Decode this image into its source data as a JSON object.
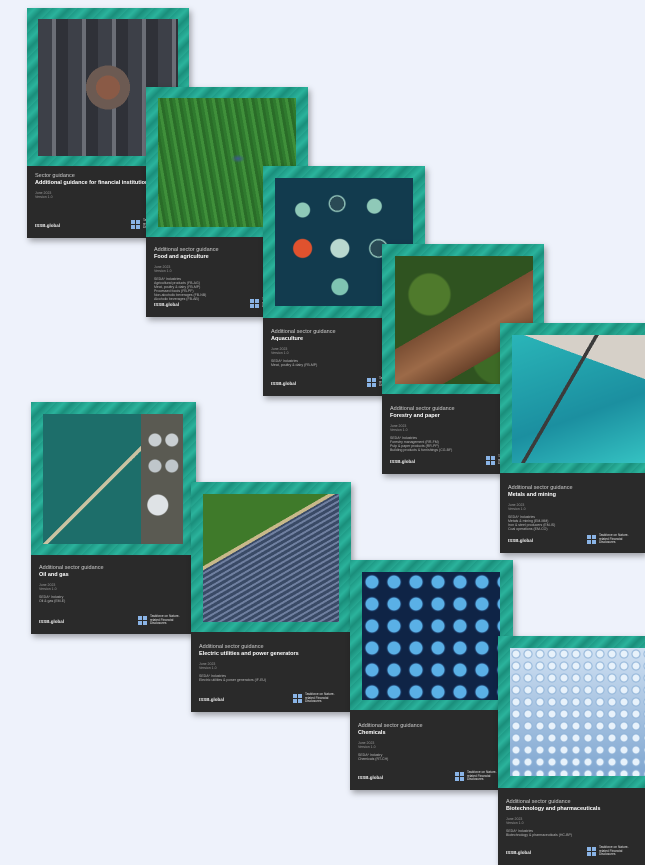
{
  "cards": [
    {
      "kicker": "Sector guidance",
      "title": "Additional guidance for financial institutions",
      "date": "June 2023\nVersion 1.0",
      "industries": "",
      "brand": "ISSB.global",
      "tcfd": "Taskforce on Nature-related Financial Disclosures"
    },
    {
      "kicker": "Additional sector guidance",
      "title": "Food and agriculture",
      "date": "June 2023\nVersion 1.0",
      "industries": "SEDA* Industries\nAgricultural products (FB-AG)\nMeat, poultry & dairy (FB-MP)\nProcessed foods (FB-PF)\nNon-alcoholic beverages (FB-NB)\nAlcoholic beverages (FB-AB)",
      "brand": "ISSB.global",
      "tcfd": "Taskforce on Nature-related Financial Disclosures"
    },
    {
      "kicker": "Additional sector guidance",
      "title": "Aquaculture",
      "date": "June 2023\nVersion 1.0",
      "industries": "SEDA* Industries\nMeat, poultry & dairy (FB-MP)",
      "brand": "ISSB.global",
      "tcfd": "Taskforce on Nature-related Financial Disclosures"
    },
    {
      "kicker": "Additional sector guidance",
      "title": "Forestry and paper",
      "date": "June 2023\nVersion 1.0",
      "industries": "SEDA* Industries\nForestry management (RR-FM)\nPulp & paper products (RR-PP)\nBuilding products & furnishings (CG-BF)",
      "brand": "ISSB.global",
      "tcfd": "Taskforce on Nature-related Financial Disclosures"
    },
    {
      "kicker": "Additional sector guidance",
      "title": "Metals and mining",
      "date": "June 2023\nVersion 1.0",
      "industries": "SEDA* Industries\nMetals & mining (EM-MM)\nIron & steel producers (EM-IS)\nCoal operations (EM-CO)",
      "brand": "ISSB.global",
      "tcfd": "Taskforce on Nature-related Financial Disclosures"
    },
    {
      "kicker": "Additional sector guidance",
      "title": "Oil and gas",
      "date": "June 2023\nVersion 1.0",
      "industries": "SEDA* Industry\nOil & gas (EM-E)",
      "brand": "ISSB.global",
      "tcfd": "Taskforce on Nature-related Financial Disclosures"
    },
    {
      "kicker": "Additional sector guidance",
      "title": "Electric utilities and power generators",
      "date": "June 2023\nVersion 1.0",
      "industries": "SEDA* Industries\nElectric utilities & power generators (IF-EU)",
      "brand": "ISSB.global",
      "tcfd": "Taskforce on Nature-related Financial Disclosures"
    },
    {
      "kicker": "Additional sector guidance",
      "title": "Chemicals",
      "date": "June 2023\nVersion 1.0",
      "industries": "SEDA* Industry\nChemicals (RT-CH)",
      "brand": "ISSB.global",
      "tcfd": "Taskforce on Nature-related Financial Disclosures"
    },
    {
      "kicker": "Additional sector guidance",
      "title": "Biotechnology and pharmaceuticals",
      "date": "June 2023\nVersion 1.0",
      "industries": "SEDA* Industries\nBiotechnology & pharmaceuticals (HC-BP)",
      "brand": "ISSB.global",
      "tcfd": "Taskforce on Nature-related Financial Disclosures"
    }
  ]
}
